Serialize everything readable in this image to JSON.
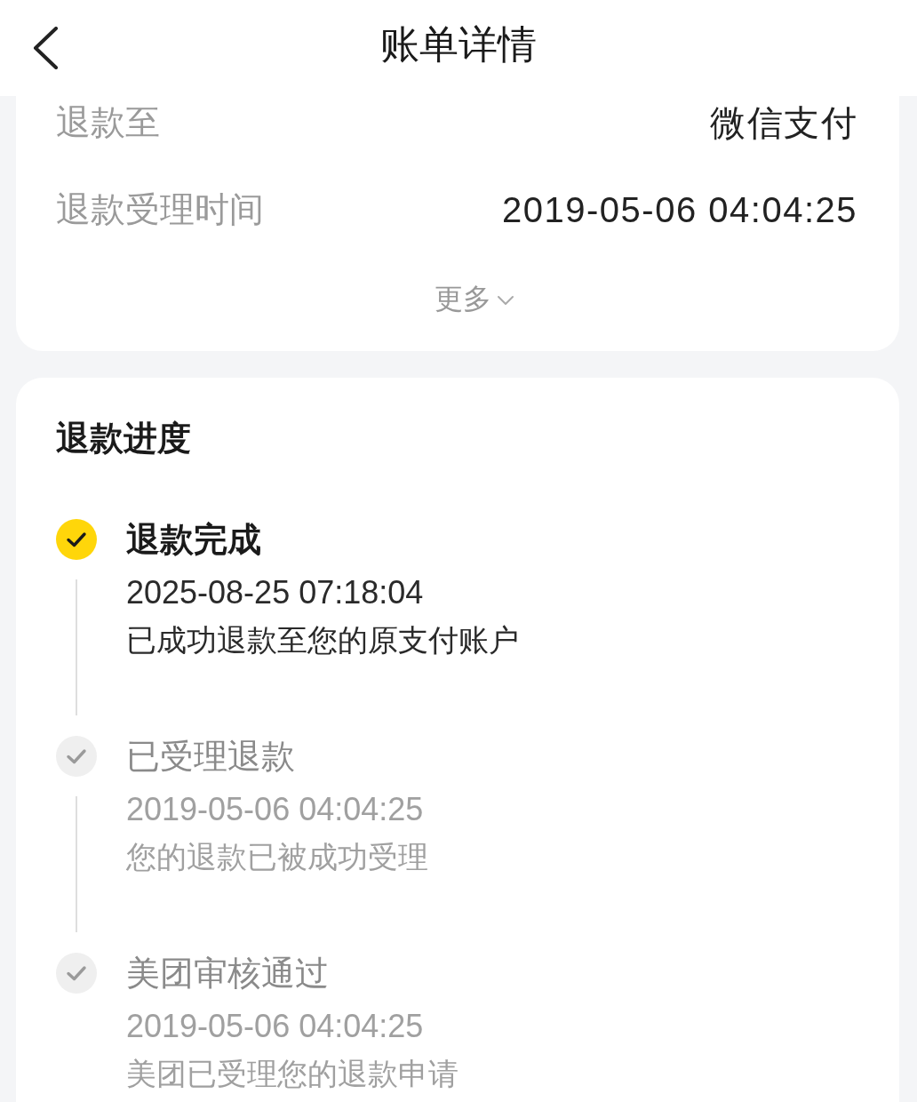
{
  "header": {
    "title": "账单详情"
  },
  "detail_card": {
    "rows": [
      {
        "label": "退款至",
        "value": "微信支付"
      },
      {
        "label": "退款受理时间",
        "value": "2019-05-06 04:04:25"
      }
    ],
    "more_link": {
      "label": "更多",
      "expanded": false
    }
  },
  "progress_card": {
    "title": "退款进度",
    "steps": [
      {
        "title": "退款完成",
        "time": "2025-08-25 07:18:04",
        "description": "已成功退款至您的原支付账户",
        "active": true
      },
      {
        "title": "已受理退款",
        "time": "2019-05-06 04:04:25",
        "description": "您的退款已被成功受理",
        "active": false
      },
      {
        "title": "美团审核通过",
        "time": "2019-05-06 04:04:25",
        "description": "美团已受理您的退款申请",
        "active": false
      }
    ]
  }
}
